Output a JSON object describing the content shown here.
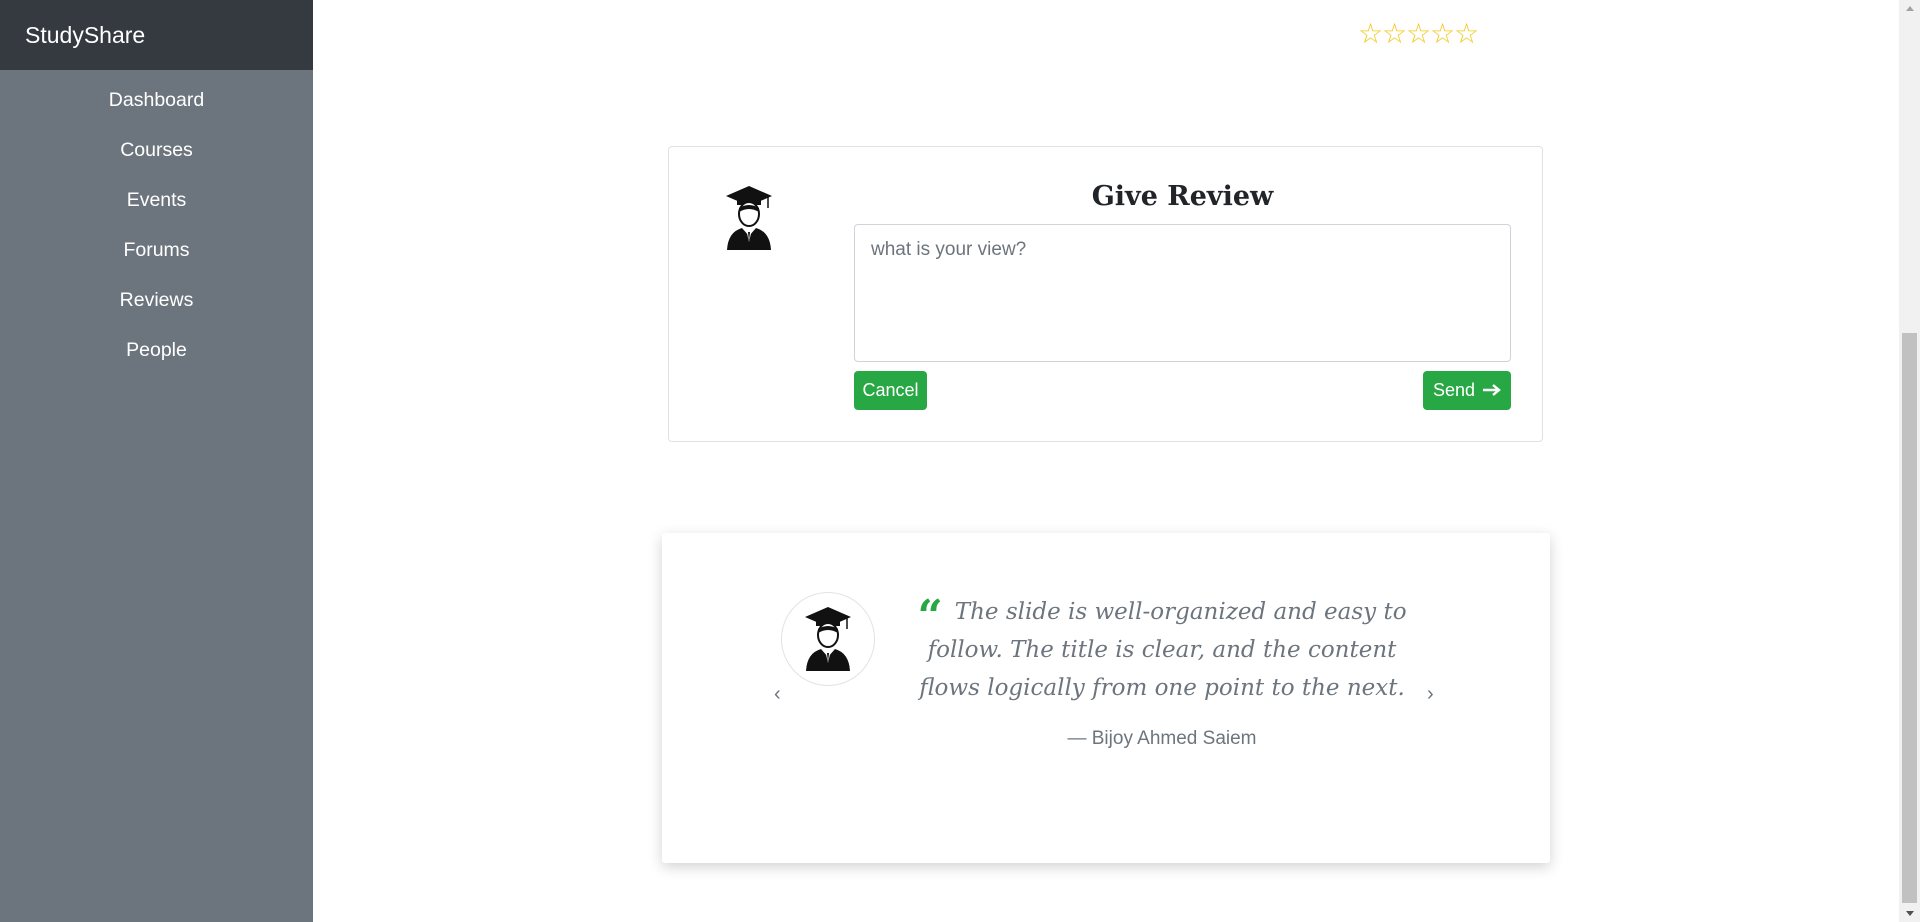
{
  "sidebar": {
    "brand": "StudyShare",
    "items": [
      {
        "label": "Dashboard"
      },
      {
        "label": "Courses"
      },
      {
        "label": "Events"
      },
      {
        "label": "Forums"
      },
      {
        "label": "Reviews"
      },
      {
        "label": "People"
      }
    ]
  },
  "rating": {
    "stars": [
      "☆",
      "☆",
      "☆",
      "☆",
      "☆"
    ],
    "value": 0,
    "max": 5,
    "color": "#f5c518"
  },
  "review_form": {
    "title": "Give Review",
    "placeholder": "what is your view?",
    "value": "",
    "cancel_label": "Cancel",
    "send_label": "Send",
    "button_color": "#28a745"
  },
  "testimonial": {
    "quote": "The slide is well-organized and easy to follow. The title is clear, and the content flows logically from one point to the next.",
    "author": "— Bijoy Ahmed Saiem",
    "quote_icon": "quote-left-icon",
    "accent_color": "#28a745"
  },
  "colors": {
    "sidebar_bg": "#6c757d",
    "brand_bg": "#343a40"
  }
}
